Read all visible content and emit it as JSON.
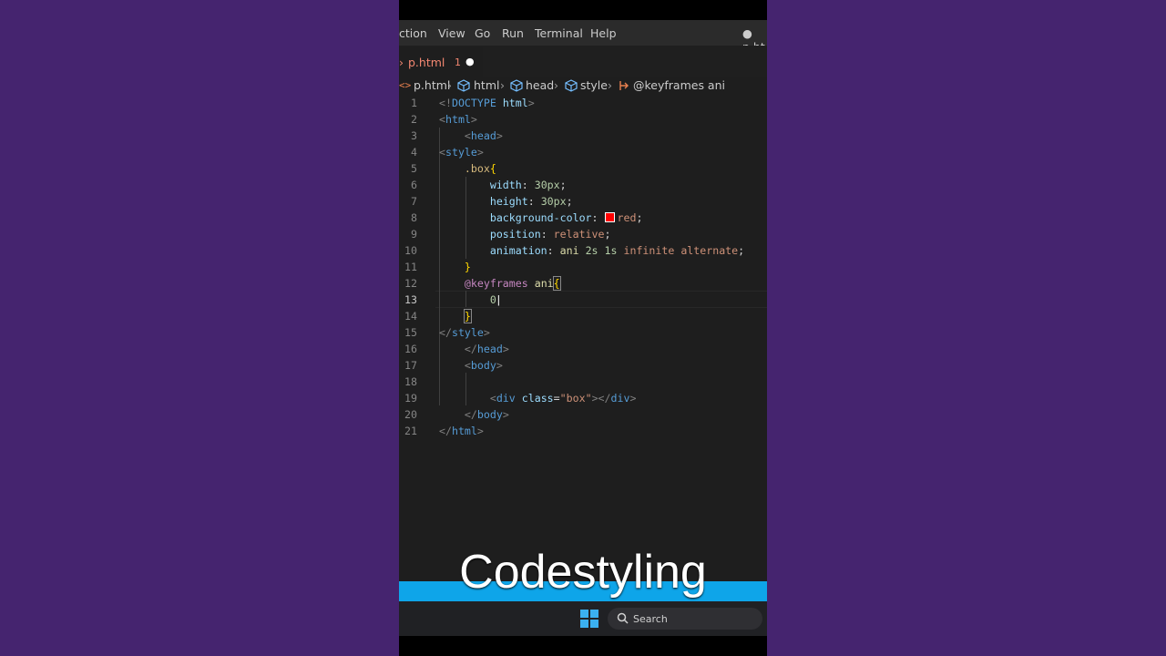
{
  "menu": {
    "items": [
      "ction",
      "View",
      "Go",
      "Run",
      "Terminal",
      "Help"
    ],
    "window_title": "● p.ht"
  },
  "tab": {
    "name": "p.html",
    "problem_count": "1",
    "unsaved_dot": "●"
  },
  "breadcrumb": {
    "items": [
      "p.html",
      "html",
      "head",
      "style",
      "@keyframes ani"
    ]
  },
  "editor": {
    "line_numbers": [
      "1",
      "2",
      "3",
      "4",
      "5",
      "6",
      "7",
      "8",
      "9",
      "10",
      "11",
      "12",
      "13",
      "14",
      "15",
      "16",
      "17",
      "18",
      "19",
      "20",
      "21"
    ],
    "active_line": "13"
  },
  "taskbar": {
    "search_label": "Search"
  },
  "watermark": "Codestyling",
  "colors": {
    "accent_stripe": "#0ea5e9",
    "swatch_red": "#ff0000",
    "editor_bg": "#1e1e1e"
  }
}
